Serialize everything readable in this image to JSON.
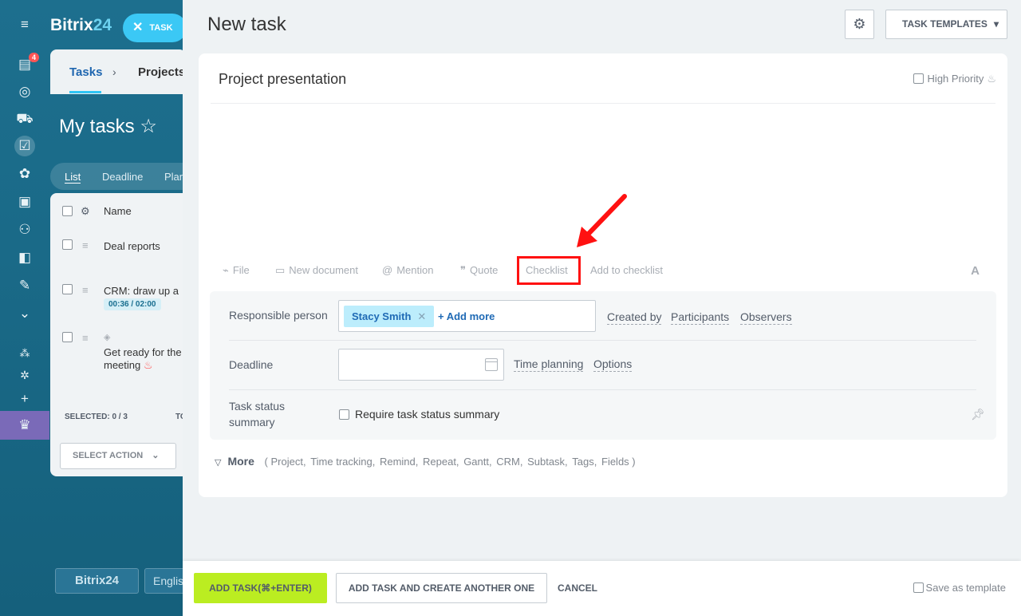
{
  "background": {
    "brand": {
      "name": "Bitrix",
      "num": "24"
    },
    "task_pill_label": "TASK",
    "rail_badge": "4",
    "tabs": {
      "tasks": "Tasks",
      "projects": "Projects"
    },
    "page_title": "My tasks",
    "views": [
      "List",
      "Deadline",
      "Plan"
    ],
    "list": {
      "header": "Name",
      "rows": [
        "Deal reports",
        "CRM: draw up a",
        "Get ready for the",
        "meeting"
      ],
      "timer": "00:36 / 02:00",
      "selected": "SELECTED: 0 / 3",
      "total_prefix": "TO",
      "select_action": "SELECT ACTION"
    },
    "footer_brand": "Bitrix24",
    "footer_lang": "English"
  },
  "slider": {
    "title": "New task",
    "templates_label": "TASK TEMPLATES",
    "task_title": "Project presentation",
    "high_priority": "High Priority",
    "toolbar": {
      "file": "File",
      "new_document": "New document",
      "mention": "Mention",
      "quote": "Quote",
      "checklist": "Checklist",
      "add_to_checklist": "Add to checklist",
      "format": "A"
    },
    "fields": {
      "responsible_label": "Responsible person",
      "responsible_value": "Stacy Smith",
      "add_more": "+ Add more",
      "created_by": "Created by",
      "participants": "Participants",
      "observers": "Observers",
      "deadline_label": "Deadline",
      "time_planning": "Time planning",
      "options": "Options",
      "status_label_1": "Task status",
      "status_label_2": "summary",
      "require_status": "Require task status summary"
    },
    "more": {
      "label": "More",
      "items": [
        "( Project,",
        "Time tracking,",
        "Remind,",
        "Repeat,",
        "Gantt,",
        "CRM,",
        "Subtask,",
        "Tags,",
        "Fields )"
      ]
    },
    "footer": {
      "add_task": "ADD TASK(⌘+ENTER)",
      "add_another": "ADD TASK AND CREATE ANOTHER ONE",
      "cancel": "CANCEL",
      "save_template": "Save as template"
    }
  }
}
